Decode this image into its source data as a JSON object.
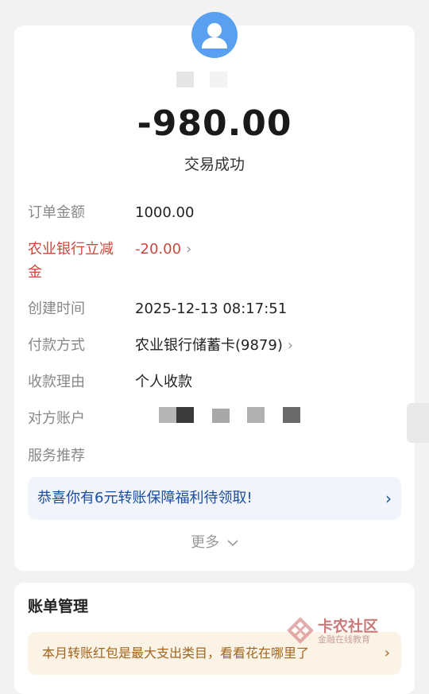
{
  "transaction": {
    "amount": "-980.00",
    "status": "交易成功"
  },
  "details": {
    "order_amount": {
      "label": "订单金额",
      "value": "1000.00"
    },
    "discount": {
      "label_line1": "农业银行立减",
      "label_line2": "金",
      "value": "-20.00"
    },
    "created_time": {
      "label": "创建时间",
      "value": "2025-12-13 08:17:51"
    },
    "payment_method": {
      "label": "付款方式",
      "value": "农业银行储蓄卡(9879)"
    },
    "reason": {
      "label": "收款理由",
      "value": "个人收款"
    },
    "counterparty": {
      "label": "对方账户"
    },
    "service": {
      "label": "服务推荐"
    }
  },
  "promo": {
    "text": "恭喜你有6元转账保障福利待领取!",
    "arrow": "›"
  },
  "more": {
    "label": "更多",
    "icon": "chevron-down-icon"
  },
  "bill": {
    "title": "账单管理",
    "tip": "本月转账红包是最大支出类目，看看花在哪里了",
    "arrow": "›"
  },
  "watermark": {
    "title": "卡农社区",
    "subtitle": "金融在线教育"
  },
  "colors": {
    "accent_red": "#c9493c",
    "link_blue": "#1b4fa0",
    "avatar_blue": "#5aa0f0"
  }
}
